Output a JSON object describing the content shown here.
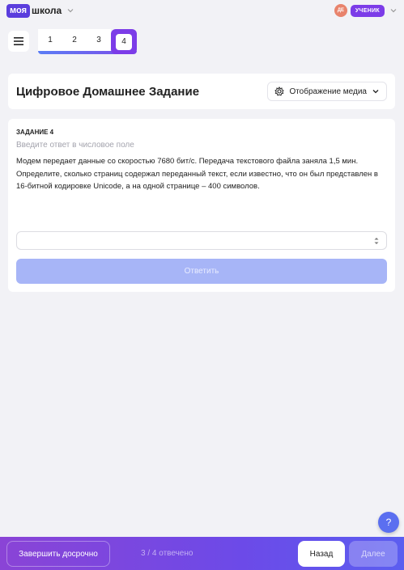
{
  "header": {
    "brand_badge": "моя",
    "brand_text": "школа",
    "avatar_initials": "ДЕ",
    "role": "УЧЕНИК"
  },
  "tabs": [
    {
      "label": "1",
      "active": false
    },
    {
      "label": "2",
      "active": false
    },
    {
      "label": "3",
      "active": false
    },
    {
      "label": "4",
      "active": true
    }
  ],
  "title_card": {
    "title": "Цифровое Домашнее Задание",
    "media_label": "Отображение медиа"
  },
  "task": {
    "label": "ЗАДАНИЕ 4",
    "hint": "Введите ответ в числовое поле",
    "text": "Модем передает данные со скоростью 7680 бит/с. Передача текстового файла заняла 1,5 мин. Определите, сколько страниц содержал переданный текст, если известно, что он был представлен в 16-битной кодировке Unicode, а на одной странице – 400 символов.",
    "answer_value": "",
    "submit_label": "Ответить"
  },
  "help": {
    "label": "?"
  },
  "footer": {
    "finish_label": "Завершить досрочно",
    "progress": "3 / 4 отвечено",
    "back_label": "Назад",
    "next_label": "Далее"
  },
  "colors": {
    "brand": "#5a3ddd",
    "accent": "#7c3ce8",
    "submit_disabled": "#a7b5f7",
    "help": "#5b6ff0"
  }
}
